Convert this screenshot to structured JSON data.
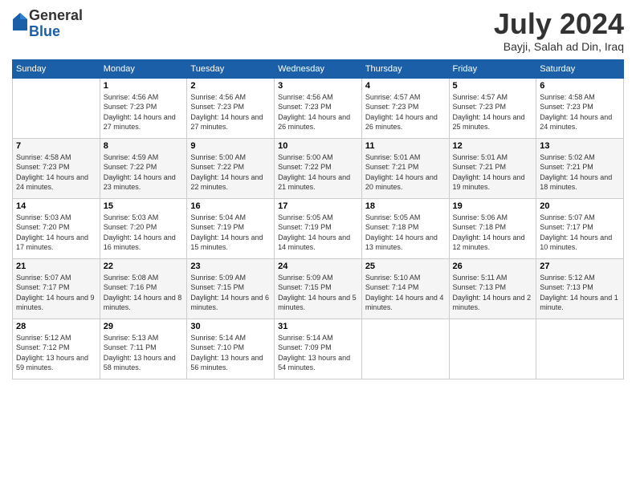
{
  "logo": {
    "general": "General",
    "blue": "Blue"
  },
  "title": {
    "month_year": "July 2024",
    "location": "Bayji, Salah ad Din, Iraq"
  },
  "weekdays": [
    "Sunday",
    "Monday",
    "Tuesday",
    "Wednesday",
    "Thursday",
    "Friday",
    "Saturday"
  ],
  "weeks": [
    [
      {
        "day": "",
        "sunrise": "",
        "sunset": "",
        "daylight": ""
      },
      {
        "day": "1",
        "sunrise": "Sunrise: 4:56 AM",
        "sunset": "Sunset: 7:23 PM",
        "daylight": "Daylight: 14 hours and 27 minutes."
      },
      {
        "day": "2",
        "sunrise": "Sunrise: 4:56 AM",
        "sunset": "Sunset: 7:23 PM",
        "daylight": "Daylight: 14 hours and 27 minutes."
      },
      {
        "day": "3",
        "sunrise": "Sunrise: 4:56 AM",
        "sunset": "Sunset: 7:23 PM",
        "daylight": "Daylight: 14 hours and 26 minutes."
      },
      {
        "day": "4",
        "sunrise": "Sunrise: 4:57 AM",
        "sunset": "Sunset: 7:23 PM",
        "daylight": "Daylight: 14 hours and 26 minutes."
      },
      {
        "day": "5",
        "sunrise": "Sunrise: 4:57 AM",
        "sunset": "Sunset: 7:23 PM",
        "daylight": "Daylight: 14 hours and 25 minutes."
      },
      {
        "day": "6",
        "sunrise": "Sunrise: 4:58 AM",
        "sunset": "Sunset: 7:23 PM",
        "daylight": "Daylight: 14 hours and 24 minutes."
      }
    ],
    [
      {
        "day": "7",
        "sunrise": "Sunrise: 4:58 AM",
        "sunset": "Sunset: 7:23 PM",
        "daylight": "Daylight: 14 hours and 24 minutes."
      },
      {
        "day": "8",
        "sunrise": "Sunrise: 4:59 AM",
        "sunset": "Sunset: 7:22 PM",
        "daylight": "Daylight: 14 hours and 23 minutes."
      },
      {
        "day": "9",
        "sunrise": "Sunrise: 5:00 AM",
        "sunset": "Sunset: 7:22 PM",
        "daylight": "Daylight: 14 hours and 22 minutes."
      },
      {
        "day": "10",
        "sunrise": "Sunrise: 5:00 AM",
        "sunset": "Sunset: 7:22 PM",
        "daylight": "Daylight: 14 hours and 21 minutes."
      },
      {
        "day": "11",
        "sunrise": "Sunrise: 5:01 AM",
        "sunset": "Sunset: 7:21 PM",
        "daylight": "Daylight: 14 hours and 20 minutes."
      },
      {
        "day": "12",
        "sunrise": "Sunrise: 5:01 AM",
        "sunset": "Sunset: 7:21 PM",
        "daylight": "Daylight: 14 hours and 19 minutes."
      },
      {
        "day": "13",
        "sunrise": "Sunrise: 5:02 AM",
        "sunset": "Sunset: 7:21 PM",
        "daylight": "Daylight: 14 hours and 18 minutes."
      }
    ],
    [
      {
        "day": "14",
        "sunrise": "Sunrise: 5:03 AM",
        "sunset": "Sunset: 7:20 PM",
        "daylight": "Daylight: 14 hours and 17 minutes."
      },
      {
        "day": "15",
        "sunrise": "Sunrise: 5:03 AM",
        "sunset": "Sunset: 7:20 PM",
        "daylight": "Daylight: 14 hours and 16 minutes."
      },
      {
        "day": "16",
        "sunrise": "Sunrise: 5:04 AM",
        "sunset": "Sunset: 7:19 PM",
        "daylight": "Daylight: 14 hours and 15 minutes."
      },
      {
        "day": "17",
        "sunrise": "Sunrise: 5:05 AM",
        "sunset": "Sunset: 7:19 PM",
        "daylight": "Daylight: 14 hours and 14 minutes."
      },
      {
        "day": "18",
        "sunrise": "Sunrise: 5:05 AM",
        "sunset": "Sunset: 7:18 PM",
        "daylight": "Daylight: 14 hours and 13 minutes."
      },
      {
        "day": "19",
        "sunrise": "Sunrise: 5:06 AM",
        "sunset": "Sunset: 7:18 PM",
        "daylight": "Daylight: 14 hours and 12 minutes."
      },
      {
        "day": "20",
        "sunrise": "Sunrise: 5:07 AM",
        "sunset": "Sunset: 7:17 PM",
        "daylight": "Daylight: 14 hours and 10 minutes."
      }
    ],
    [
      {
        "day": "21",
        "sunrise": "Sunrise: 5:07 AM",
        "sunset": "Sunset: 7:17 PM",
        "daylight": "Daylight: 14 hours and 9 minutes."
      },
      {
        "day": "22",
        "sunrise": "Sunrise: 5:08 AM",
        "sunset": "Sunset: 7:16 PM",
        "daylight": "Daylight: 14 hours and 8 minutes."
      },
      {
        "day": "23",
        "sunrise": "Sunrise: 5:09 AM",
        "sunset": "Sunset: 7:15 PM",
        "daylight": "Daylight: 14 hours and 6 minutes."
      },
      {
        "day": "24",
        "sunrise": "Sunrise: 5:09 AM",
        "sunset": "Sunset: 7:15 PM",
        "daylight": "Daylight: 14 hours and 5 minutes."
      },
      {
        "day": "25",
        "sunrise": "Sunrise: 5:10 AM",
        "sunset": "Sunset: 7:14 PM",
        "daylight": "Daylight: 14 hours and 4 minutes."
      },
      {
        "day": "26",
        "sunrise": "Sunrise: 5:11 AM",
        "sunset": "Sunset: 7:13 PM",
        "daylight": "Daylight: 14 hours and 2 minutes."
      },
      {
        "day": "27",
        "sunrise": "Sunrise: 5:12 AM",
        "sunset": "Sunset: 7:13 PM",
        "daylight": "Daylight: 14 hours and 1 minute."
      }
    ],
    [
      {
        "day": "28",
        "sunrise": "Sunrise: 5:12 AM",
        "sunset": "Sunset: 7:12 PM",
        "daylight": "Daylight: 13 hours and 59 minutes."
      },
      {
        "day": "29",
        "sunrise": "Sunrise: 5:13 AM",
        "sunset": "Sunset: 7:11 PM",
        "daylight": "Daylight: 13 hours and 58 minutes."
      },
      {
        "day": "30",
        "sunrise": "Sunrise: 5:14 AM",
        "sunset": "Sunset: 7:10 PM",
        "daylight": "Daylight: 13 hours and 56 minutes."
      },
      {
        "day": "31",
        "sunrise": "Sunrise: 5:14 AM",
        "sunset": "Sunset: 7:09 PM",
        "daylight": "Daylight: 13 hours and 54 minutes."
      },
      {
        "day": "",
        "sunrise": "",
        "sunset": "",
        "daylight": ""
      },
      {
        "day": "",
        "sunrise": "",
        "sunset": "",
        "daylight": ""
      },
      {
        "day": "",
        "sunrise": "",
        "sunset": "",
        "daylight": ""
      }
    ]
  ]
}
